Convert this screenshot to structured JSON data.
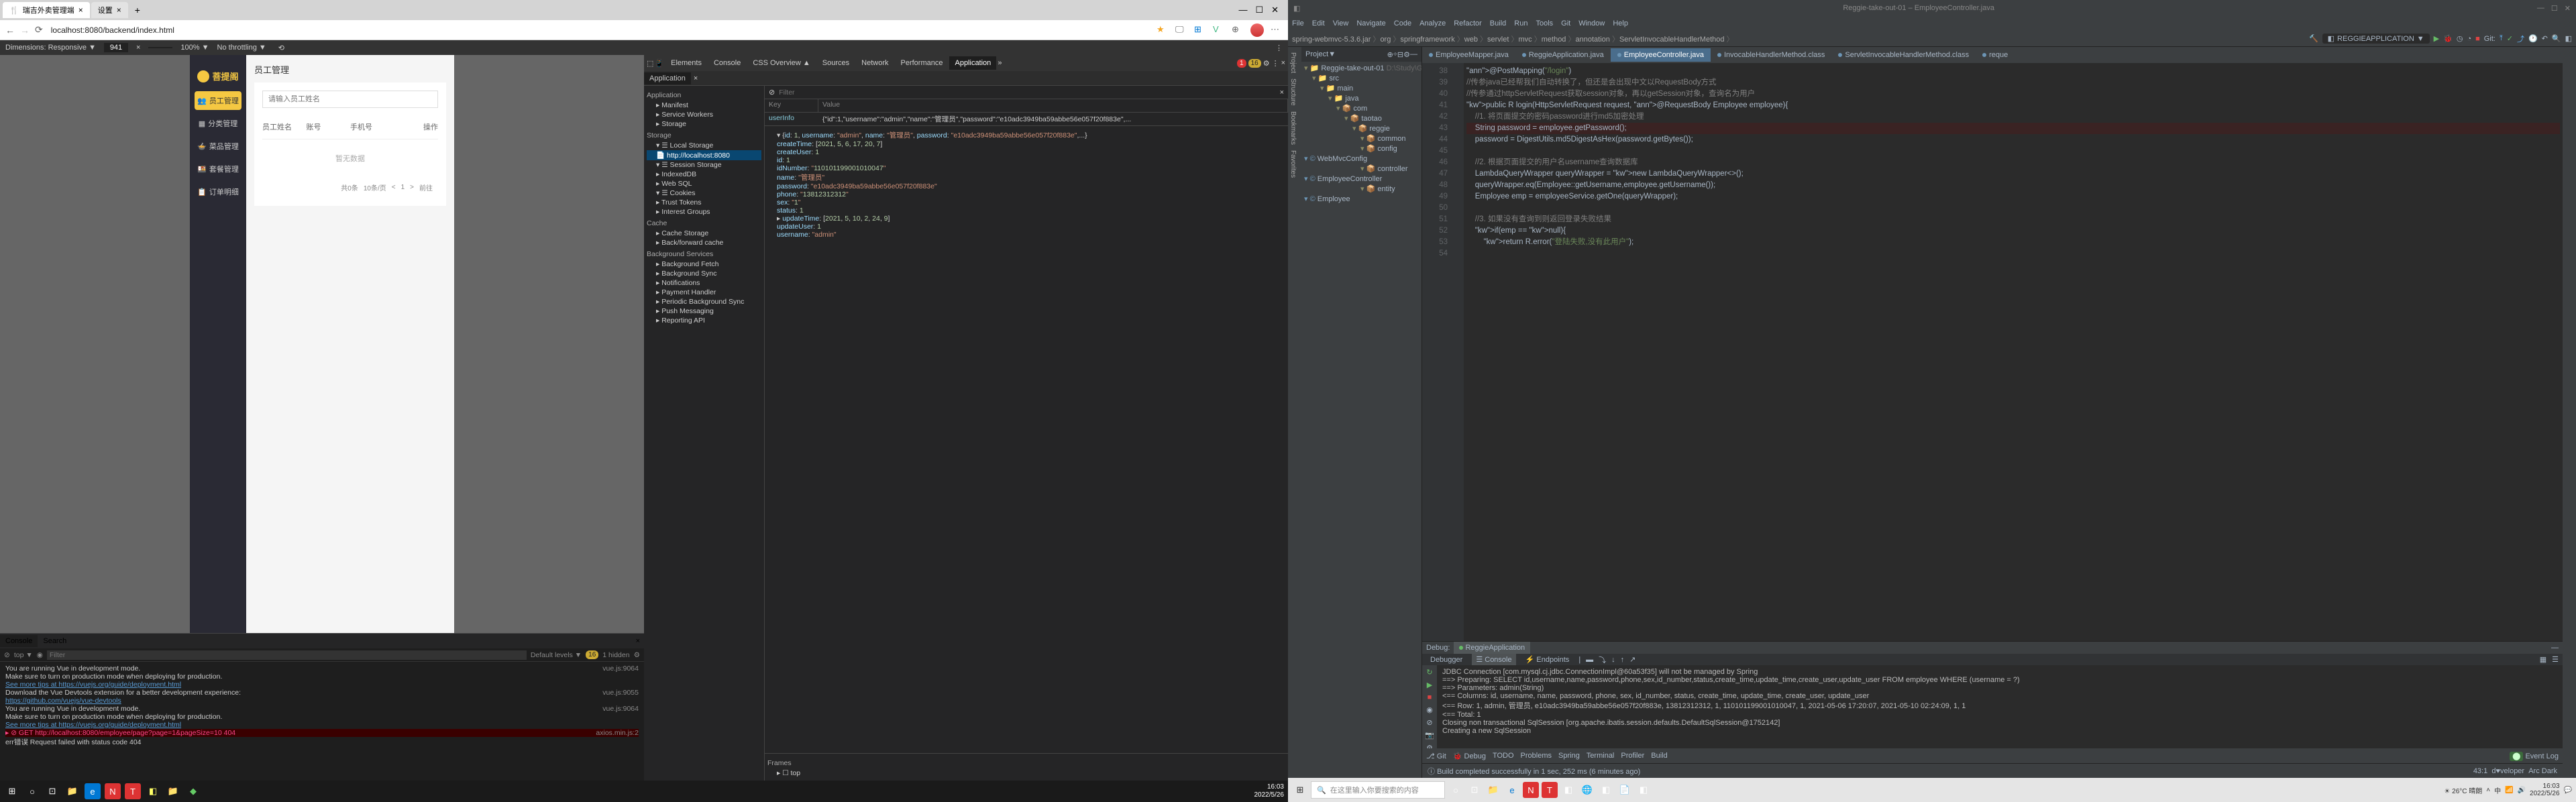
{
  "browser": {
    "tabs": [
      {
        "title": "瑞吉外卖管理端",
        "active": true
      },
      {
        "title": "设置",
        "active": false
      }
    ],
    "url": "localhost:8080/backend/index.html",
    "window_ctrls": [
      "—",
      "☐",
      "✕"
    ]
  },
  "responsive_bar": {
    "label": "Dimensions: Responsive ▼",
    "w": "941",
    "h": "",
    "zoom": "100% ▼",
    "throttle": "No throttling ▼"
  },
  "app": {
    "brand": "菩提阁",
    "nav": [
      {
        "icon": "👥",
        "label": "员工管理",
        "active": true
      },
      {
        "icon": "▦",
        "label": "分类管理"
      },
      {
        "icon": "🍲",
        "label": "菜品管理"
      },
      {
        "icon": "🍱",
        "label": "套餐管理"
      },
      {
        "icon": "📋",
        "label": "订单明细"
      }
    ],
    "page_title": "员工管理",
    "search_placeholder": "请输入员工姓名",
    "cols": [
      "员工姓名",
      "账号",
      "手机号",
      "",
      "操作"
    ],
    "empty": "暂无数据",
    "pagination": {
      "total": "共0条",
      "pageSize": "10条/页",
      "page": "1",
      "prev": "<",
      "next": ">",
      "goto": "前往"
    }
  },
  "devtools": {
    "tabs": [
      "Elements",
      "Console",
      "CSS Overview ▲",
      "Sources",
      "Network",
      "Performance",
      "Application"
    ],
    "active": "Application",
    "badges": {
      "errors": "1",
      "warns": "16"
    },
    "filter": "Filter",
    "storage": {
      "sections": {
        "Application": [
          "Manifest",
          "Service Workers",
          "Storage"
        ],
        "Storage": [
          "Local Storage",
          "http://localhost:8080",
          "Session Storage",
          "IndexedDB",
          "Web SQL",
          "Cookies",
          "Trust Tokens",
          "Interest Groups"
        ],
        "Cache": [
          "Cache Storage",
          "Back/forward cache"
        ],
        "Background Services": [
          "Background Fetch",
          "Background Sync",
          "Notifications",
          "Payment Handler",
          "Periodic Background Sync",
          "Push Messaging",
          "Reporting API"
        ],
        "Frames": [
          "top"
        ]
      },
      "selected": "http://localhost:8080",
      "kv": {
        "key": "Key",
        "val": "Value",
        "row_key": "userInfo",
        "row_val": "{\"id\":1,\"username\":\"admin\",\"name\":\"管理员\",\"password\":\"e10adc3949ba59abbe56e057f20f883e\",..."
      },
      "json_lines": [
        "▾ {id: 1, username: \"admin\", name: \"管理员\", password: \"e10adc3949ba59abbe56e057f20f883e\",...}",
        "  createTime: [2021, 5, 6, 17, 20, 7]",
        "  createUser: 1",
        "  id: 1",
        "  idNumber: \"110101199001010047\"",
        "  name: \"管理员\"",
        "  password: \"e10adc3949ba59abbe56e057f20f883e\"",
        "  phone: \"13812312312\"",
        "  sex: \"1\"",
        "  status: 1",
        "▸ updateTime: [2021, 5, 10, 2, 24, 9]",
        "  updateUser: 1",
        "  username: \"admin\""
      ]
    },
    "console": {
      "tabs": [
        "Console",
        "Search"
      ],
      "filter_placeholder": "Filter",
      "levels": "Default levels ▼",
      "issues": "16",
      "hidden": "1 hidden",
      "lines": [
        {
          "text": "You are running Vue in development mode.",
          "right": "vue.js:9064"
        },
        {
          "text": "Make sure to turn on production mode when deploying for production."
        },
        {
          "text": "See more tips at https://vuejs.org/guide/deployment.html",
          "link": true
        },
        {
          "text": "Download the Vue Devtools extension for a better development experience:",
          "right": "vue.js:9055"
        },
        {
          "text": "https://github.com/vuejs/vue-devtools",
          "link": true
        },
        {
          "text": "You are running Vue in development mode.",
          "right": "vue.js:9064"
        },
        {
          "text": "Make sure to turn on production mode when deploying for production."
        },
        {
          "text": "See more tips at https://vuejs.org/guide/deployment.html",
          "link": true
        },
        {
          "err": true,
          "text": "▸ ⊘ GET http://localhost:8080/employee/page?page=1&pageSize=10 404",
          "right": "axios.min.js:2"
        },
        {
          "text": "  err错误 Request failed with status code 404"
        }
      ]
    }
  },
  "taskbar_left": {
    "time": "16:03",
    "date": "2022/5/26"
  },
  "ide": {
    "title_right": "Reggie-take-out-01 – EmployeeController.java",
    "menu": [
      "File",
      "Edit",
      "View",
      "Navigate",
      "Code",
      "Analyze",
      "Refactor",
      "Build",
      "Run",
      "Tools",
      "Git",
      "Window",
      "Help"
    ],
    "crumbs": [
      "spring-webmvc-5.3.6.jar",
      "org",
      "springframework",
      "web",
      "servlet",
      "mvc",
      "method",
      "annotation",
      "ServletInvocableHandlerMethod"
    ],
    "run_config": "REGGIEAPPLICATION",
    "project_header": "Project",
    "project_tree": [
      {
        "l": 0,
        "icon": "📁",
        "text": "Reggie-take-out-01",
        "suffix": " D:\\Study\\GitCode\\reggie-tak"
      },
      {
        "l": 1,
        "icon": "📁",
        "text": "src"
      },
      {
        "l": 2,
        "icon": "📁",
        "text": "main"
      },
      {
        "l": 3,
        "icon": "📁",
        "text": "java"
      },
      {
        "l": 4,
        "icon": "📦",
        "text": "com"
      },
      {
        "l": 5,
        "icon": "📦",
        "text": "taotao"
      },
      {
        "l": 6,
        "icon": "📦",
        "text": "reggie"
      },
      {
        "l": 7,
        "icon": "📦",
        "text": "common"
      },
      {
        "l": 7,
        "icon": "📦",
        "text": "config"
      },
      {
        "l": 8,
        "icon": "©",
        "text": "WebMvcConfig"
      },
      {
        "l": 7,
        "icon": "📦",
        "text": "controller"
      },
      {
        "l": 8,
        "icon": "©",
        "text": "EmployeeController"
      },
      {
        "l": 7,
        "icon": "📦",
        "text": "entity"
      },
      {
        "l": 8,
        "icon": "©",
        "text": "Employee"
      }
    ],
    "editor_tabs": [
      {
        "name": "EmployeeMapper.java"
      },
      {
        "name": "ReggieApplication.java"
      },
      {
        "name": "EmployeeController.java",
        "hl": true
      },
      {
        "name": "InvocableHandlerMethod.class"
      },
      {
        "name": "ServletInvocableHandlerMethod.class"
      },
      {
        "name": "reque",
        "overflow": true
      }
    ],
    "gutter_lines": [
      "",
      "",
      "38",
      "39",
      "40",
      "41",
      "42",
      "",
      "43",
      "44",
      "45",
      "46",
      "47",
      "48",
      "49",
      "50",
      "51",
      "52",
      "53",
      "54"
    ],
    "code_lines": [
      {
        "t": "@PostMapping(\"/login\")",
        "cls": "ann"
      },
      {
        "t": "//传参java已经帮我们自动转换了，但还是会出现中文以RequestBody方式",
        "cls": "cmt"
      },
      {
        "t": "//传参通过httpServletRequest获取session对象，再以getSession对象，查询名为用户",
        "cls": "cmt"
      },
      {
        "t": "public R<Employee> login(HttpServletRequest request, @RequestBody Employee employee){",
        "cls": ""
      },
      {
        "t": "    //1. 将页面提交的密码password进行md5加密处理",
        "cls": "cmt"
      },
      {
        "t": "    String password = employee.getPassword();",
        "cls": "",
        "bp": true
      },
      {
        "t": "    password = DigestUtils.md5DigestAsHex(password.getBytes());",
        "cls": ""
      },
      {
        "t": "",
        "cls": ""
      },
      {
        "t": "    //2. 根据页面提交的用户名username查询数据库",
        "cls": "cmt"
      },
      {
        "t": "    LambdaQueryWrapper<Employee> queryWrapper = new LambdaQueryWrapper<>();",
        "cls": ""
      },
      {
        "t": "    queryWrapper.eq(Employee::getUsername,employee.getUsername());",
        "cls": ""
      },
      {
        "t": "    Employee emp = employeeService.getOne(queryWrapper);",
        "cls": ""
      },
      {
        "t": "",
        "cls": ""
      },
      {
        "t": "    //3. 如果没有查询到则返回登录失败结果",
        "cls": "cmt"
      },
      {
        "t": "    if(emp == null){",
        "cls": ""
      },
      {
        "t": "        return R.error(\"登陆失败,没有此用户\");",
        "cls": ""
      }
    ],
    "debug": {
      "title": "Debug:",
      "tab": "ReggieApplication",
      "subtabs": [
        "Debugger",
        "Console",
        "Endpoints"
      ],
      "console": [
        "JDBC Connection [com.mysql.cj.jdbc.ConnectionImpl@60a53f35] will not be managed by Spring",
        "==>  Preparing: SELECT id,username,name,password,phone,sex,id_number,status,create_time,update_time,create_user,update_user FROM employee WHERE (username = ?)",
        "==> Parameters: admin(String)",
        "<==    Columns: id, username, name, password, phone, sex, id_number, status, create_time, update_time, create_user, update_user",
        "<==        Row: 1, admin, 管理员, e10adc3949ba59abbe56e057f20f883e, 13812312312, 1, 110101199001010047, 1, 2021-05-06 17:20:07, 2021-05-10 02:24:09, 1, 1",
        "<==      Total: 1",
        "Closing non transactional SqlSession [org.apache.ibatis.session.defaults.DefaultSqlSession@1752142]",
        "Creating a new SqlSession"
      ]
    },
    "bottom_tabs": [
      "Git",
      "Debug",
      "TODO",
      "Problems",
      "Spring",
      "Terminal",
      "Profiler",
      "Build"
    ],
    "event_log": "Event Log",
    "status": {
      "msg": "Build completed successfully in 1 sec, 252 ms (6 minutes ago)",
      "pos": "43:1",
      "branch": "d♥veloper",
      "theme": "Arc Dark"
    }
  },
  "taskbar_right": {
    "search": "在这里输入你要搜索的内容",
    "weather": "26°C 晴朗",
    "time": "16:03",
    "date": "2022/5/26"
  }
}
